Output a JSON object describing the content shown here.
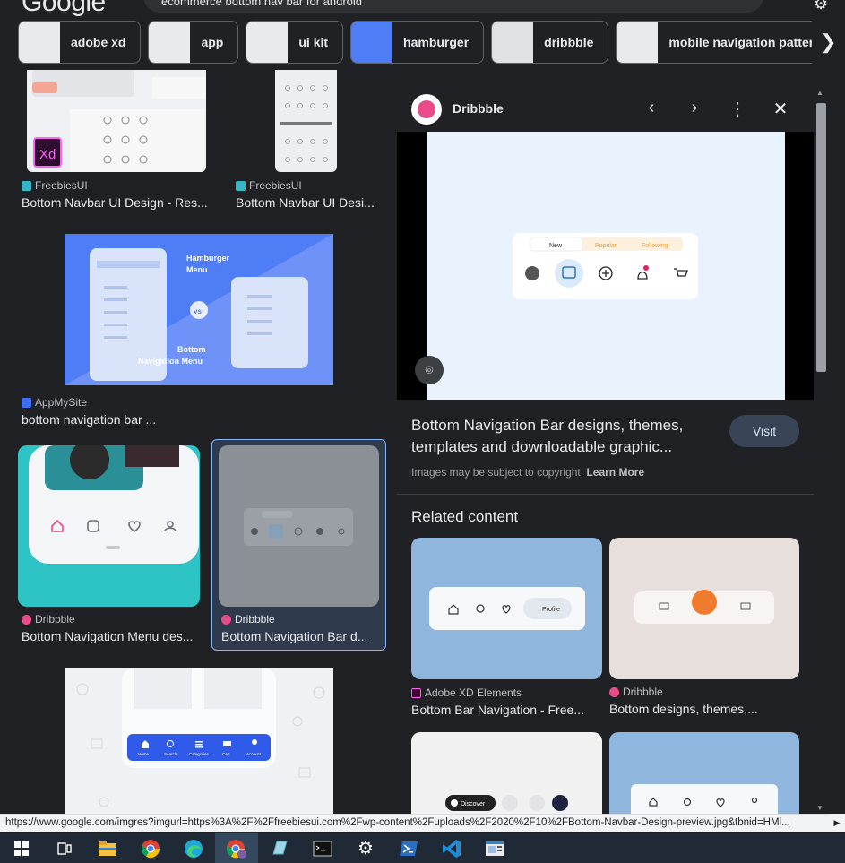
{
  "header": {
    "logo": "Google",
    "search_query": "ecommerce bottom nav bar for android"
  },
  "chips": [
    {
      "label": "adobe xd"
    },
    {
      "label": "app"
    },
    {
      "label": "ui kit"
    },
    {
      "label": "hamburger"
    },
    {
      "label": "dribbble"
    },
    {
      "label": "mobile navigation pattern"
    }
  ],
  "results": [
    {
      "source": "FreebiesUI",
      "caption": "Bottom Navbar UI Design - Res..."
    },
    {
      "source": "FreebiesUI",
      "caption": "Bottom Navbar UI Desi..."
    },
    {
      "source": "AppMySite",
      "caption": "bottom navigation bar ..."
    },
    {
      "source": "Dribbble",
      "caption": "Bottom Navigation Menu des..."
    },
    {
      "source": "Dribbble",
      "caption": "Bottom Navigation Bar d..."
    }
  ],
  "result_image_text": {
    "xd_badge": "Xd",
    "hamburger_title": "Hamburger Menu",
    "vs": "vs",
    "bottom_nav_title": "Bottom Navigation Menu",
    "mini_tabs": [
      "New",
      "Popular",
      "Following"
    ],
    "nav_labels": [
      "Home",
      "Search",
      "Categories",
      "Cart",
      "Account"
    ]
  },
  "panel": {
    "site": "Dribbble",
    "title": "Bottom Navigation Bar designs, themes, templates and downloadable graphic...",
    "visit_label": "Visit",
    "copyright": "Images may be subject to copyright.",
    "learn_more": "Learn More",
    "preview_tabs": [
      "New",
      "Popular",
      "Following"
    ],
    "related_heading": "Related content",
    "related": [
      {
        "source": "Adobe XD Elements",
        "caption": "Bottom Bar Navigation - Free...",
        "chip_label": "Profile"
      },
      {
        "source": "Dribbble",
        "caption": "Bottom designs, themes,..."
      },
      {
        "chip_label": "Discover"
      }
    ]
  },
  "status_url": "https://www.google.com/imgres?imgurl=https%3A%2F%2Ffreebiesui.com%2Fwp-content%2Fuploads%2F2020%2F10%2FBottom-Navbar-Design-preview.jpg&tbnid=HMl...",
  "colors": {
    "background": "#202124",
    "accent": "#8ab4f8",
    "dribbble": "#ea4c89",
    "blue_tile": "#4f7df5",
    "teal_tile": "#2ec4c6"
  }
}
